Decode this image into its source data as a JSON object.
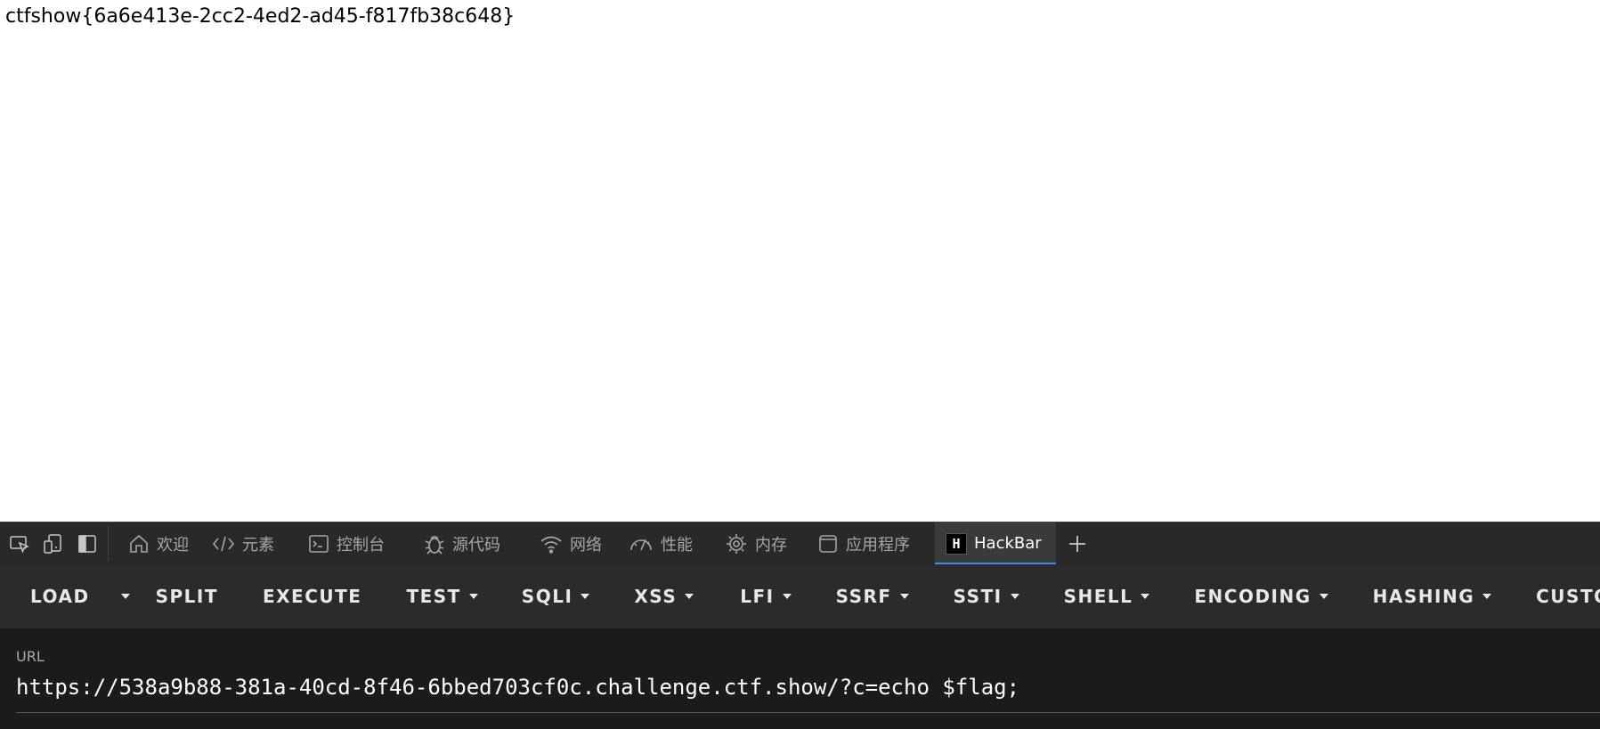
{
  "page": {
    "content_text": "ctfshow{6a6e413e-2cc2-4ed2-ad45-f817fb38c648}"
  },
  "devtools": {
    "tools": [
      {
        "name": "inspect-element-icon"
      },
      {
        "name": "device-emulation-icon"
      },
      {
        "name": "dock-side-icon"
      }
    ],
    "tabs": [
      {
        "label": "欢迎",
        "icon": "home-icon"
      },
      {
        "label": "元素",
        "icon": "code-icon"
      },
      {
        "label": "控制台",
        "icon": "console-icon"
      },
      {
        "label": "源代码",
        "icon": "bug-icon"
      },
      {
        "label": "网络",
        "icon": "wifi-icon"
      },
      {
        "label": "性能",
        "icon": "gauge-icon"
      },
      {
        "label": "内存",
        "icon": "chip-icon"
      },
      {
        "label": "应用程序",
        "icon": "app-icon"
      },
      {
        "label": "HackBar",
        "icon": "hackbar-logo",
        "logo_letter": "H",
        "active": true
      }
    ],
    "add_tab_icon": "plus-icon",
    "accent_color": "#3b8ee8"
  },
  "hackbar": {
    "buttons": [
      {
        "label": "LOAD",
        "dropdown": false
      },
      {
        "label": "SPLIT",
        "dropdown": false
      },
      {
        "label": "EXECUTE",
        "dropdown": false
      },
      {
        "label": "TEST",
        "dropdown": true
      },
      {
        "label": "SQLI",
        "dropdown": true
      },
      {
        "label": "XSS",
        "dropdown": true
      },
      {
        "label": "LFI",
        "dropdown": true
      },
      {
        "label": "SSRF",
        "dropdown": true
      },
      {
        "label": "SSTI",
        "dropdown": true
      },
      {
        "label": "SHELL",
        "dropdown": true
      },
      {
        "label": "ENCODING",
        "dropdown": true
      },
      {
        "label": "HASHING",
        "dropdown": true
      },
      {
        "label": "CUSTOM",
        "dropdown": true
      }
    ],
    "url_label": "URL",
    "url_value": "https://538a9b88-381a-40cd-8f46-6bbed703cf0c.challenge.ctf.show/?c=echo $flag;"
  }
}
